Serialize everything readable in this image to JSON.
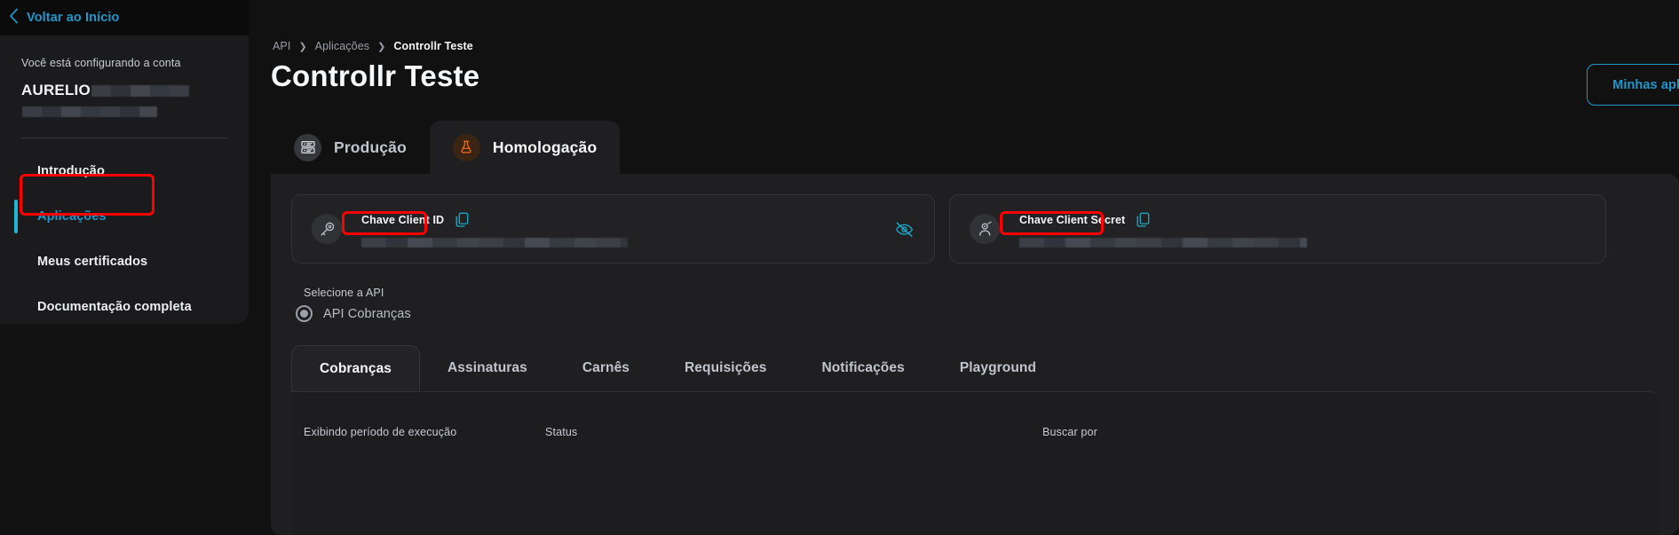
{
  "topbar": {
    "back_label": "Voltar ao Início",
    "back_icon": "chevron-left-icon"
  },
  "sidebar": {
    "account_caption": "Você está configurando a conta",
    "account_name": "AURELIO",
    "account_name_redacted": true,
    "items": [
      {
        "label": "Introdução",
        "active": false
      },
      {
        "label": "Aplicações",
        "active": true
      },
      {
        "label": "Meus certificados",
        "active": false
      },
      {
        "label": "Documentação completa",
        "active": false
      }
    ]
  },
  "header": {
    "breadcrumb": [
      {
        "label": "API",
        "current": false
      },
      {
        "label": "Aplicações",
        "current": false
      },
      {
        "label": "Controllr Teste",
        "current": true
      }
    ],
    "breadcrumb_separator": "❯",
    "title": "Controllr Teste",
    "minhas_button_label": "Minhas aplicações"
  },
  "env_tabs": [
    {
      "label": "Produção",
      "icon": "server-icon",
      "active": false
    },
    {
      "label": "Homologação",
      "icon": "flask-icon",
      "active": true
    }
  ],
  "keys": {
    "client_id": {
      "label": "Chave Client ID",
      "icon": "key-icon",
      "copy_icon": "copy-icon",
      "value_redacted": true,
      "eye_icon": "eye-off-icon"
    },
    "client_secret": {
      "label": "Chave Client Secret",
      "icon": "user-key-icon",
      "copy_icon": "copy-icon",
      "value_redacted": true
    }
  },
  "api_select": {
    "label": "Selecione a API",
    "options": [
      {
        "label": "API Cobranças",
        "selected": true
      }
    ]
  },
  "api_tabs": [
    {
      "label": "Cobranças",
      "active": true
    },
    {
      "label": "Assinaturas",
      "active": false
    },
    {
      "label": "Carnês",
      "active": false
    },
    {
      "label": "Requisições",
      "active": false
    },
    {
      "label": "Notificações",
      "active": false
    },
    {
      "label": "Playground",
      "active": false
    }
  ],
  "filters": {
    "periodo_label": "Exibindo período de execução",
    "status_label": "Status",
    "buscar_label": "Buscar por"
  },
  "colors": {
    "accent_cyan": "#2196c9",
    "accent_bar": "#20b7d4",
    "annotation_red": "#fe0000",
    "homolog_orange": "#e8661b",
    "page_bg": "#111112",
    "panel_bg": "#1f1f21",
    "sidebar_bg": "#1b1b1d"
  }
}
